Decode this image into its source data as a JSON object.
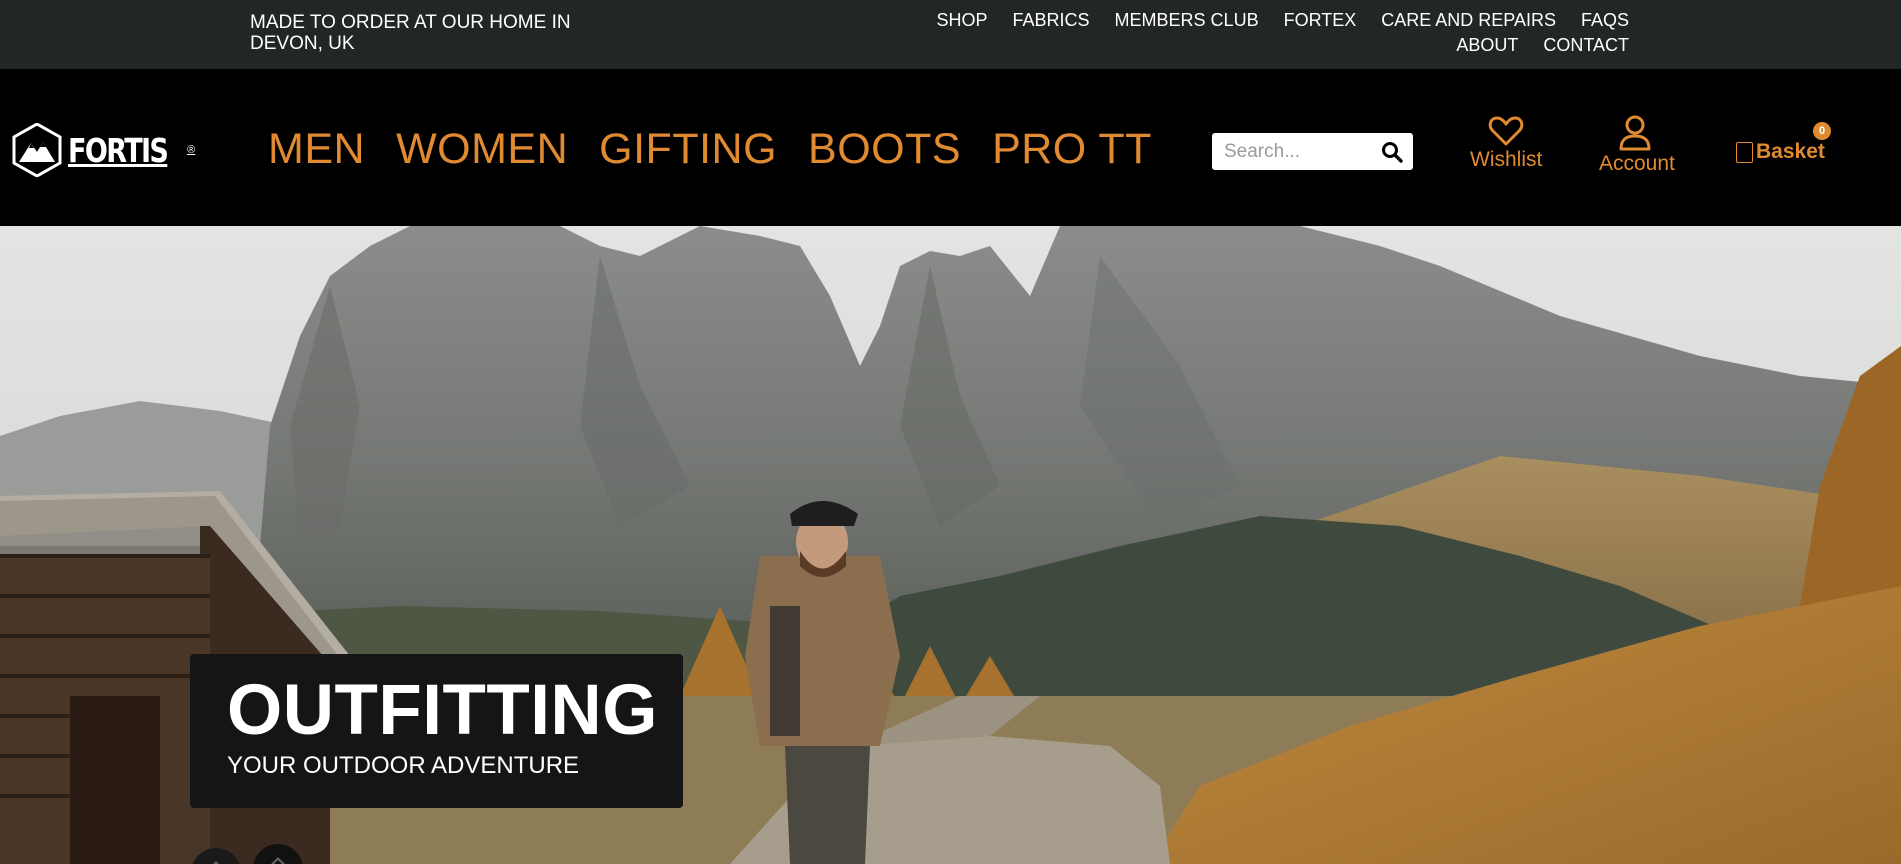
{
  "topbar": {
    "tagline": "MADE TO ORDER AT OUR HOME IN DEVON, UK",
    "links_row1": [
      "SHOP",
      "FABRICS",
      "MEMBERS CLUB",
      "FORTEX",
      "CARE AND REPAIRS",
      "FAQS"
    ],
    "links_row2": [
      "ABOUT",
      "CONTACT"
    ]
  },
  "header": {
    "logo_text": "FORTIS",
    "logo_reg": "®",
    "nav": [
      "MEN",
      "WOMEN",
      "GIFTING",
      "BOOTS",
      "PRO TT"
    ],
    "search_placeholder": "Search...",
    "wishlist_label": "Wishlist",
    "account_label": "Account",
    "basket_label": "Basket",
    "basket_count": "0"
  },
  "hero": {
    "headline": "OUTFITTING",
    "subheadline": "YOUR OUTDOOR ADVENTURE"
  },
  "icons": {
    "logo": "mountain-shield-icon",
    "search": "search-icon",
    "wishlist": "heart-icon",
    "account": "user-icon",
    "basket": "bag-icon"
  },
  "colors": {
    "accent": "#e08a32",
    "topbar_bg": "#232627",
    "header_bg": "#000000",
    "hero_card_bg": "#151515"
  }
}
